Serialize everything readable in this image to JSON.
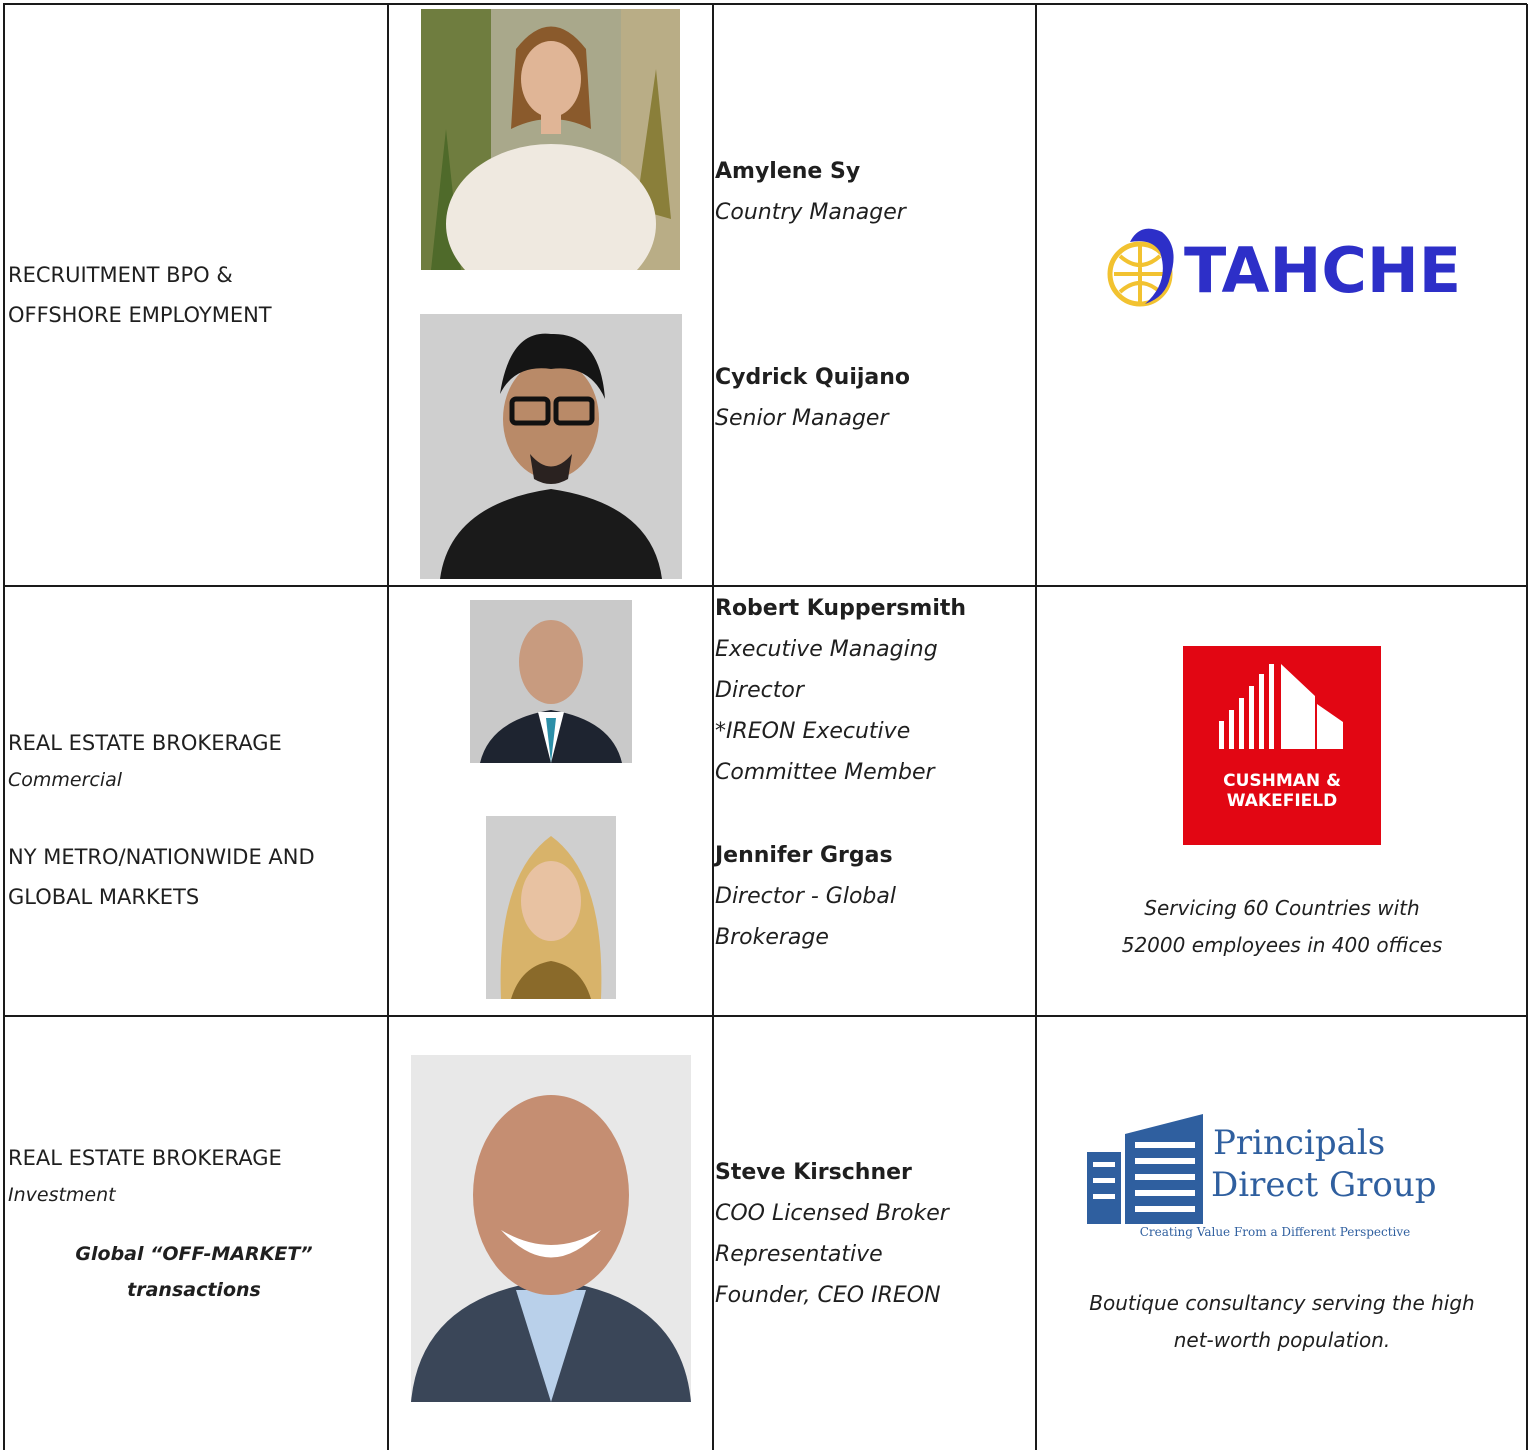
{
  "rows": [
    {
      "sector": {
        "lines": [
          "RECRUITMENT BPO &",
          "OFFSHORE EMPLOYMENT"
        ]
      },
      "people": [
        {
          "name": "Amylene Sy",
          "roles": [
            "Country Manager"
          ]
        },
        {
          "name": "Cydrick Quijano",
          "roles": [
            "Senior Manager"
          ]
        }
      ],
      "company": {
        "logo_text": "TAHCHE",
        "logo_color": "#2d2fc8",
        "accent_color": "#f2c230"
      }
    },
    {
      "sector": {
        "title": "REAL ESTATE BROKERAGE",
        "subtitle": "Commercial",
        "markets": [
          "NY METRO/NATIONWIDE AND",
          "GLOBAL MARKETS"
        ]
      },
      "people": [
        {
          "name": "Robert Kuppersmith",
          "roles": [
            "Executive Managing",
            "Director",
            "*IREON Executive",
            "Committee Member"
          ]
        },
        {
          "name": "Jennifer Grgas",
          "roles": [
            "Director - Global",
            "Brokerage"
          ]
        }
      ],
      "company": {
        "logo_lines": [
          "CUSHMAN &",
          "WAKEFIELD"
        ],
        "logo_color": "#e20613",
        "note_lines": [
          "Servicing 60 Countries with",
          "52000 employees in 400 offices"
        ]
      }
    },
    {
      "sector": {
        "title": "REAL ESTATE BROKERAGE",
        "subtitle": "Investment",
        "emphasis": [
          "Global “OFF-MARKET”",
          "transactions"
        ]
      },
      "people": [
        {
          "name": "Steve Kirschner",
          "roles": [
            "COO Licensed Broker",
            "Representative",
            "Founder, CEO IREON"
          ]
        }
      ],
      "company": {
        "logo_lines": [
          "Principals",
          "Direct Group"
        ],
        "tagline": "Creating Value From a Different Perspective",
        "logo_color": "#2f5f9f",
        "note_lines": [
          "Boutique consultancy serving the high",
          "net-worth population."
        ]
      }
    }
  ]
}
